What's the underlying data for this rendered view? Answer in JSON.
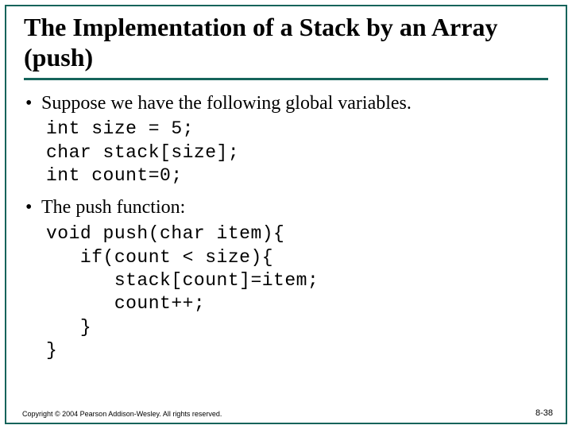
{
  "title": "The Implementation of a Stack by an Array (push)",
  "bullet1": "Suppose we have the following global variables.",
  "code1_l1": "int size = 5;",
  "code1_l2": "char stack[size];",
  "code1_l3": "int count=0;",
  "bullet2": "The push function:",
  "code2_l1": "void push(char item){",
  "code2_l2": "   if(count < size){",
  "code2_l3": "      stack[count]=item;",
  "code2_l4": "      count++;",
  "code2_l5": "   }",
  "code2_l6": "}",
  "footer_left": "Copyright © 2004 Pearson Addison-Wesley. All rights reserved.",
  "footer_right": "8-38"
}
